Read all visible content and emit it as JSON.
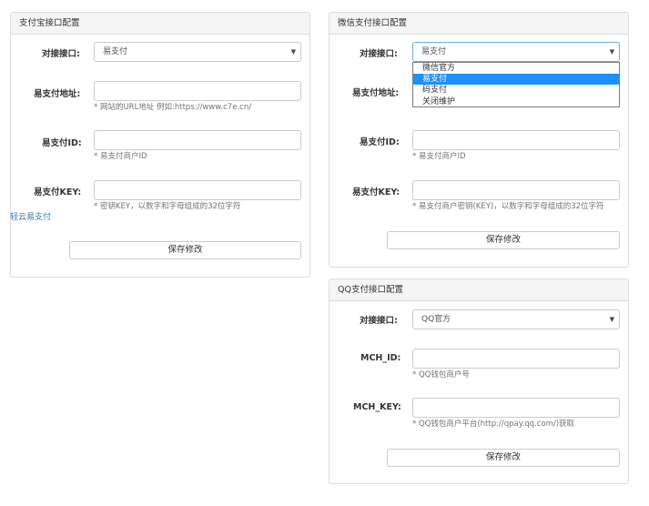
{
  "alipay": {
    "title": "支付宝接口配置",
    "interface_label": "对接接口:",
    "interface_value": "易支付",
    "url_label": "易支付地址:",
    "url_help": "* 网站的URL地址 例如:https://www.c7e.cn/",
    "id_label": "易支付ID:",
    "id_help": "* 易支付商户ID",
    "key_label": "易支付KEY:",
    "key_help": "* 密钥KEY，以数字和字母组成的32位字符",
    "link": "轻云易支付",
    "save": "保存修改"
  },
  "wechat": {
    "title": "微信支付接口配置",
    "interface_label": "对接接口:",
    "interface_value": "易支付",
    "options": [
      "微信官方",
      "易支付",
      "码支付",
      "关闭维护"
    ],
    "selected_option": "易支付",
    "url_label": "易支付地址:",
    "id_label": "易支付ID:",
    "id_help": "* 易支付商户ID",
    "key_label": "易支付KEY:",
    "key_help": "* 易支付商户密钥(KEY)，以数字和字母组成的32位字符",
    "save": "保存修改"
  },
  "qq": {
    "title": "QQ支付接口配置",
    "interface_label": "对接接口:",
    "interface_value": "QQ官方",
    "mchid_label": "MCH_ID:",
    "mchid_help": "* QQ钱包商户号",
    "mchkey_label": "MCH_KEY:",
    "mchkey_help": "* QQ钱包商户平台(http://qpay.qq.com/)获取",
    "save": "保存修改"
  },
  "icons": {
    "select_arrow": "caret-down-icon"
  },
  "colors": {
    "focus_border": "#66afe9",
    "selected_option": "#1e90ff",
    "link": "#337ab7"
  }
}
